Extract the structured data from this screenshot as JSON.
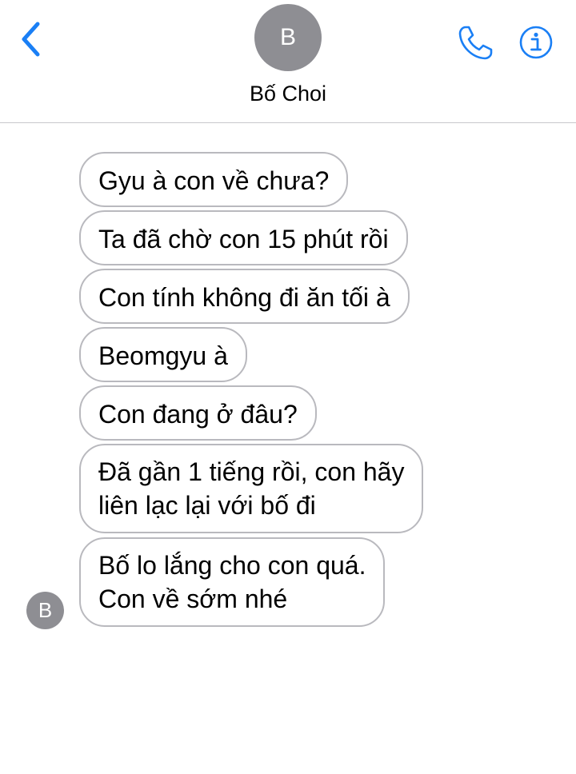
{
  "header": {
    "contact_initial": "B",
    "contact_name": "Bố Choi",
    "accent_color": "#1a7ff5",
    "icons": [
      "chevron-left-icon",
      "phone-icon",
      "info-icon"
    ]
  },
  "messages": [
    {
      "lines": [
        "Gyu à con về chưa?"
      ]
    },
    {
      "lines": [
        "Ta đã chờ con 15 phút rồi"
      ]
    },
    {
      "lines": [
        "Con tính không đi ăn tối à"
      ]
    },
    {
      "lines": [
        "Beomgyu à"
      ]
    },
    {
      "lines": [
        "Con đang ở đâu?"
      ]
    },
    {
      "lines": [
        "Đã gần 1 tiếng rồi, con hãy",
        "liên lạc lại với bố đi"
      ]
    },
    {
      "lines": [
        "Bố lo lắng cho con quá.",
        "Con về sớm nhé"
      ]
    }
  ],
  "sender_avatar_initial": "B"
}
